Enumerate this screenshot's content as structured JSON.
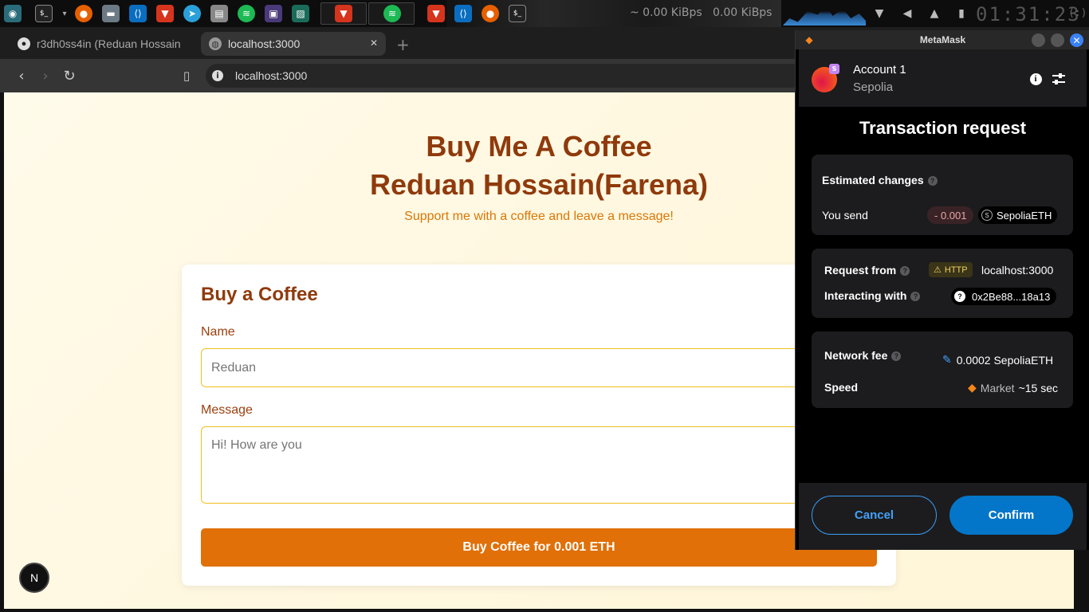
{
  "system_panel": {
    "net_down": "~ 0.00 KiBps",
    "net_up": "0.00 KiBps",
    "clock": "01:31:23",
    "clock_extra": "(:)"
  },
  "browser": {
    "tabs": [
      {
        "label": "r3dh0ss4in (Reduan Hossain",
        "icon": "github-icon",
        "active": false
      },
      {
        "label": "localhost:3000",
        "icon": "globe-icon",
        "active": true
      }
    ],
    "close_tab_glyph": "✕",
    "new_tab_glyph": "+",
    "url": "localhost:3000"
  },
  "page": {
    "heading_line1": "Buy Me A Coffee",
    "heading_line2": "Reduan Hossain(Farena)",
    "subtitle": "Support me with a coffee and leave a message!",
    "card_title": "Buy a Coffee",
    "name_label": "Name",
    "name_placeholder": "Reduan",
    "message_label": "Message",
    "message_placeholder": "Hi! How are you",
    "submit_label": "Buy Coffee for 0.001 ETH",
    "badge_letter": "N"
  },
  "metamask": {
    "window_title": "MetaMask",
    "account_name": "Account 1",
    "network": "Sepolia",
    "network_initial": "S",
    "request_title": "Transaction request",
    "estimated_changes_label": "Estimated changes",
    "you_send_label": "You send",
    "send_amount": "- 0.001",
    "send_token": "SepoliaETH",
    "request_from_label": "Request from",
    "http_badge": "HTTP",
    "request_origin": "localhost:3000",
    "interacting_label": "Interacting with",
    "contract_address": "0x2Be88...18a13",
    "network_fee_label": "Network fee",
    "network_fee_value": "0.0002 SepoliaETH",
    "speed_label": "Speed",
    "speed_value": "Market",
    "speed_time": "~15 sec",
    "cancel_label": "Cancel",
    "confirm_label": "Confirm"
  },
  "colors": {
    "accent_orange": "#e07007",
    "heading_brown": "#8f3a0c",
    "metamask_blue": "#0376c9"
  }
}
